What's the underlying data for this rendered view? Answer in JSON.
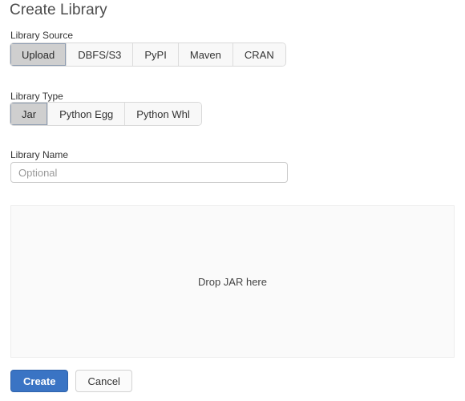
{
  "page": {
    "title": "Create Library"
  },
  "library_source": {
    "label": "Library Source",
    "options": [
      {
        "label": "Upload",
        "selected": true
      },
      {
        "label": "DBFS/S3",
        "selected": false
      },
      {
        "label": "PyPI",
        "selected": false
      },
      {
        "label": "Maven",
        "selected": false
      },
      {
        "label": "CRAN",
        "selected": false
      }
    ],
    "selected_value": "Upload"
  },
  "library_type": {
    "label": "Library Type",
    "options": [
      {
        "label": "Jar",
        "selected": true
      },
      {
        "label": "Python Egg",
        "selected": false
      },
      {
        "label": "Python Whl",
        "selected": false
      }
    ],
    "selected_value": "Jar"
  },
  "library_name": {
    "label": "Library Name",
    "value": "",
    "placeholder": "Optional"
  },
  "dropzone": {
    "text": "Drop JAR here"
  },
  "footer": {
    "create_label": "Create",
    "cancel_label": "Cancel"
  },
  "colors": {
    "primary_button": "#3a74c4",
    "selected_segment": "#cfcfcf",
    "selected_segment_border": "#8c9bb0",
    "segment_background": "#f8f8f8",
    "dropzone_background": "#fafafa",
    "title_text": "#4c4c4c",
    "placeholder_text": "#999999"
  }
}
